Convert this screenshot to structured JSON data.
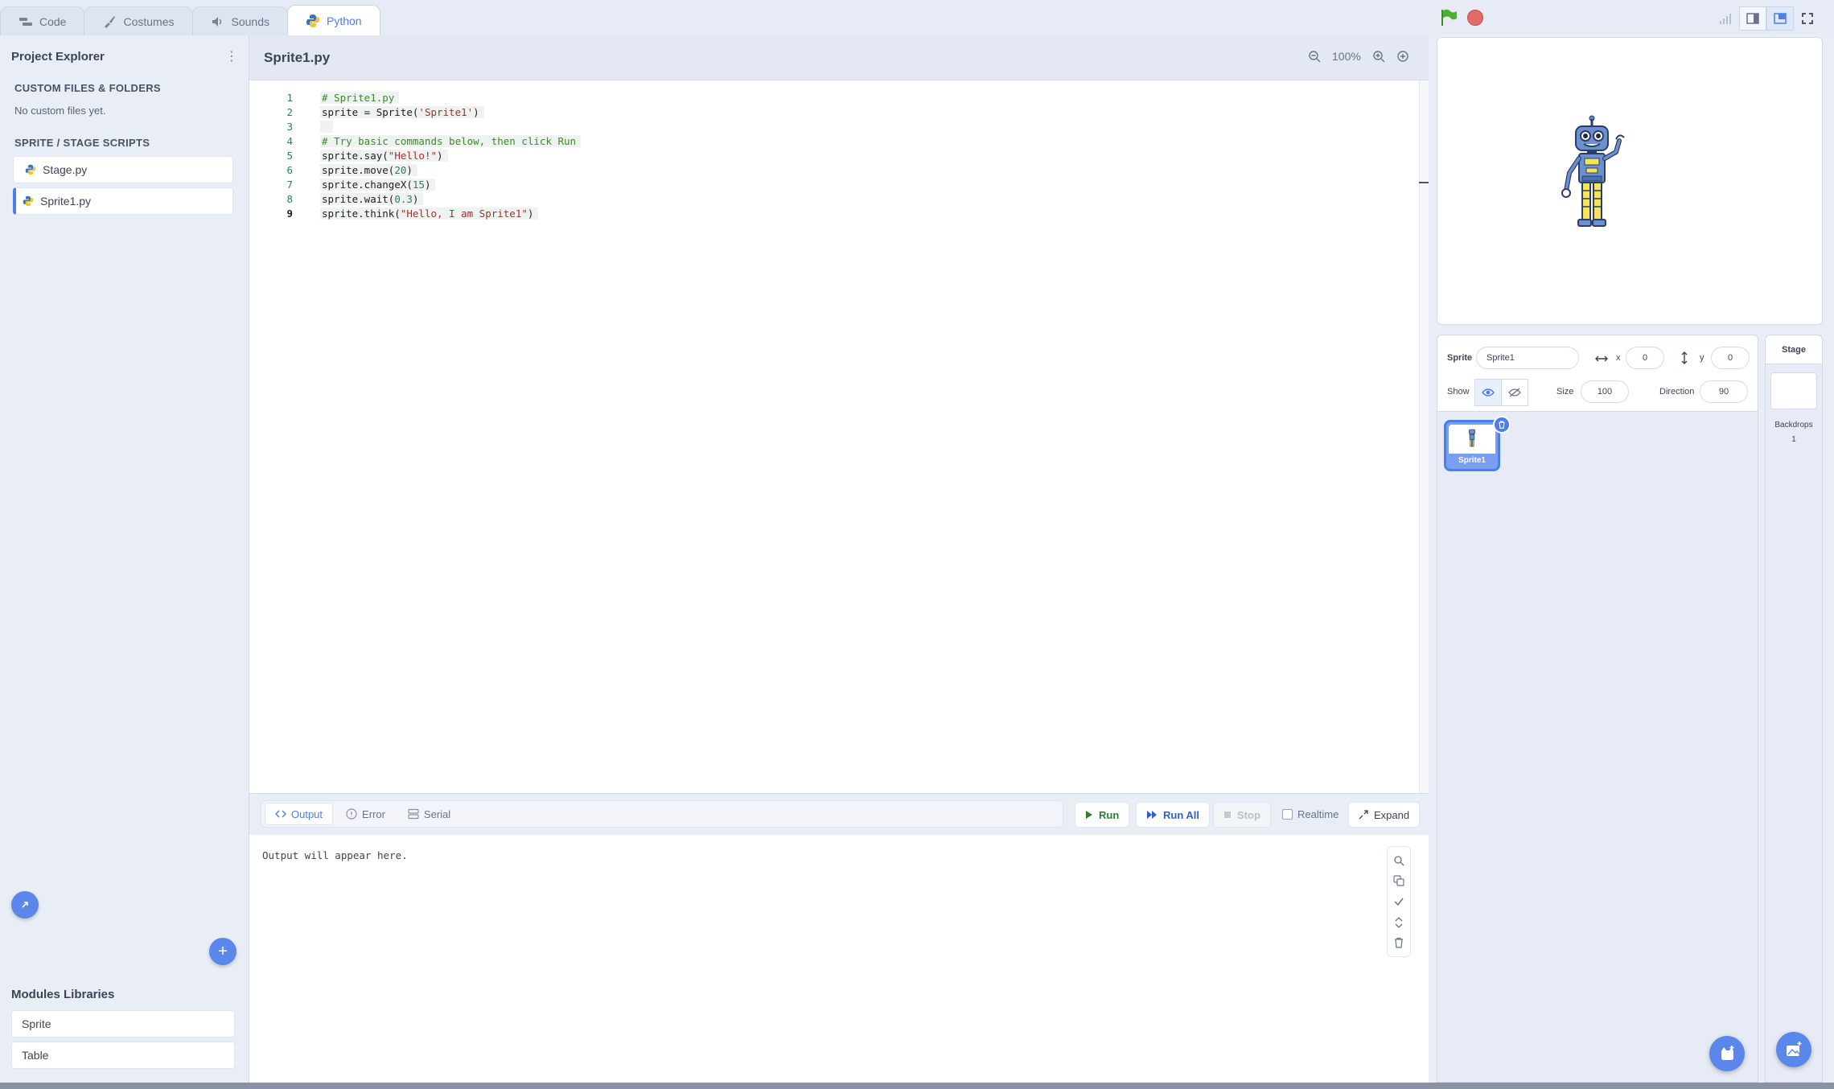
{
  "tabs": [
    {
      "label": "Code",
      "icon": "code-blocks-icon"
    },
    {
      "label": "Costumes",
      "icon": "brush-icon"
    },
    {
      "label": "Sounds",
      "icon": "speaker-icon"
    },
    {
      "label": "Python",
      "icon": "python-icon",
      "active": true
    }
  ],
  "project_explorer": {
    "title": "Project Explorer",
    "custom_section": "CUSTOM FILES & FOLDERS",
    "custom_empty": "No custom files yet.",
    "scripts_section": "SPRITE / STAGE SCRIPTS",
    "scripts": [
      {
        "label": "Stage.py"
      },
      {
        "label": "Sprite1.py",
        "active": true
      }
    ],
    "add_symbol": "+"
  },
  "modules": {
    "title": "Modules Libraries",
    "items": [
      "Sprite",
      "Table"
    ]
  },
  "editor": {
    "file_title": "Sprite1.py",
    "zoom": "100%",
    "lines": [
      {
        "n": "1",
        "parts": [
          {
            "t": "# Sprite1.py",
            "c": "com"
          }
        ]
      },
      {
        "n": "2",
        "parts": [
          {
            "t": "sprite = Sprite(",
            "c": ""
          },
          {
            "t": "'Sprite1'",
            "c": "str"
          },
          {
            "t": ")",
            "c": ""
          }
        ]
      },
      {
        "n": "3",
        "parts": [
          {
            "t": "",
            "c": ""
          }
        ]
      },
      {
        "n": "4",
        "parts": [
          {
            "t": "# Try basic commands below, then click Run",
            "c": "com"
          }
        ]
      },
      {
        "n": "5",
        "parts": [
          {
            "t": "sprite.say(",
            "c": ""
          },
          {
            "t": "\"Hello!\"",
            "c": "str"
          },
          {
            "t": ")",
            "c": ""
          }
        ]
      },
      {
        "n": "6",
        "parts": [
          {
            "t": "sprite.move(",
            "c": ""
          },
          {
            "t": "20",
            "c": "num"
          },
          {
            "t": ")",
            "c": ""
          }
        ]
      },
      {
        "n": "7",
        "parts": [
          {
            "t": "sprite.changeX(",
            "c": ""
          },
          {
            "t": "15",
            "c": "num"
          },
          {
            "t": ")",
            "c": ""
          }
        ]
      },
      {
        "n": "8",
        "parts": [
          {
            "t": "sprite.wait(",
            "c": ""
          },
          {
            "t": "0.3",
            "c": "num"
          },
          {
            "t": ")",
            "c": ""
          }
        ]
      },
      {
        "n": "9",
        "parts": [
          {
            "t": "sprite.think(",
            "c": ""
          },
          {
            "t": "\"Hello, I am Sprite1\"",
            "c": "str"
          },
          {
            "t": ")",
            "c": ""
          }
        ],
        "current": true
      }
    ]
  },
  "output": {
    "tabs": [
      {
        "label": "Output",
        "active": true
      },
      {
        "label": "Error"
      },
      {
        "label": "Serial"
      }
    ],
    "run_label": "Run",
    "run_all_label": "Run All",
    "stop_label": "Stop",
    "realtime_label": "Realtime",
    "expand_label": "Expand",
    "placeholder": "Output will appear here."
  },
  "sprite_info": {
    "sprite_label": "Sprite",
    "name": "Sprite1",
    "x_label": "x",
    "x": "0",
    "y_label": "y",
    "y": "0",
    "show_label": "Show",
    "size_label": "Size",
    "size": "100",
    "direction_label": "Direction",
    "direction": "90"
  },
  "sprites": [
    {
      "name": "Sprite1",
      "selected": true
    }
  ],
  "stage_panel": {
    "title": "Stage",
    "backdrops_label": "Backdrops",
    "backdrops_count": "1"
  },
  "colors": {
    "accent": "#4c7ee9",
    "comment": "#3d8a2a",
    "string": "#a3312a",
    "number": "#2e7d6b",
    "run": "#2f7d32",
    "run_all": "#2f5fcf"
  }
}
